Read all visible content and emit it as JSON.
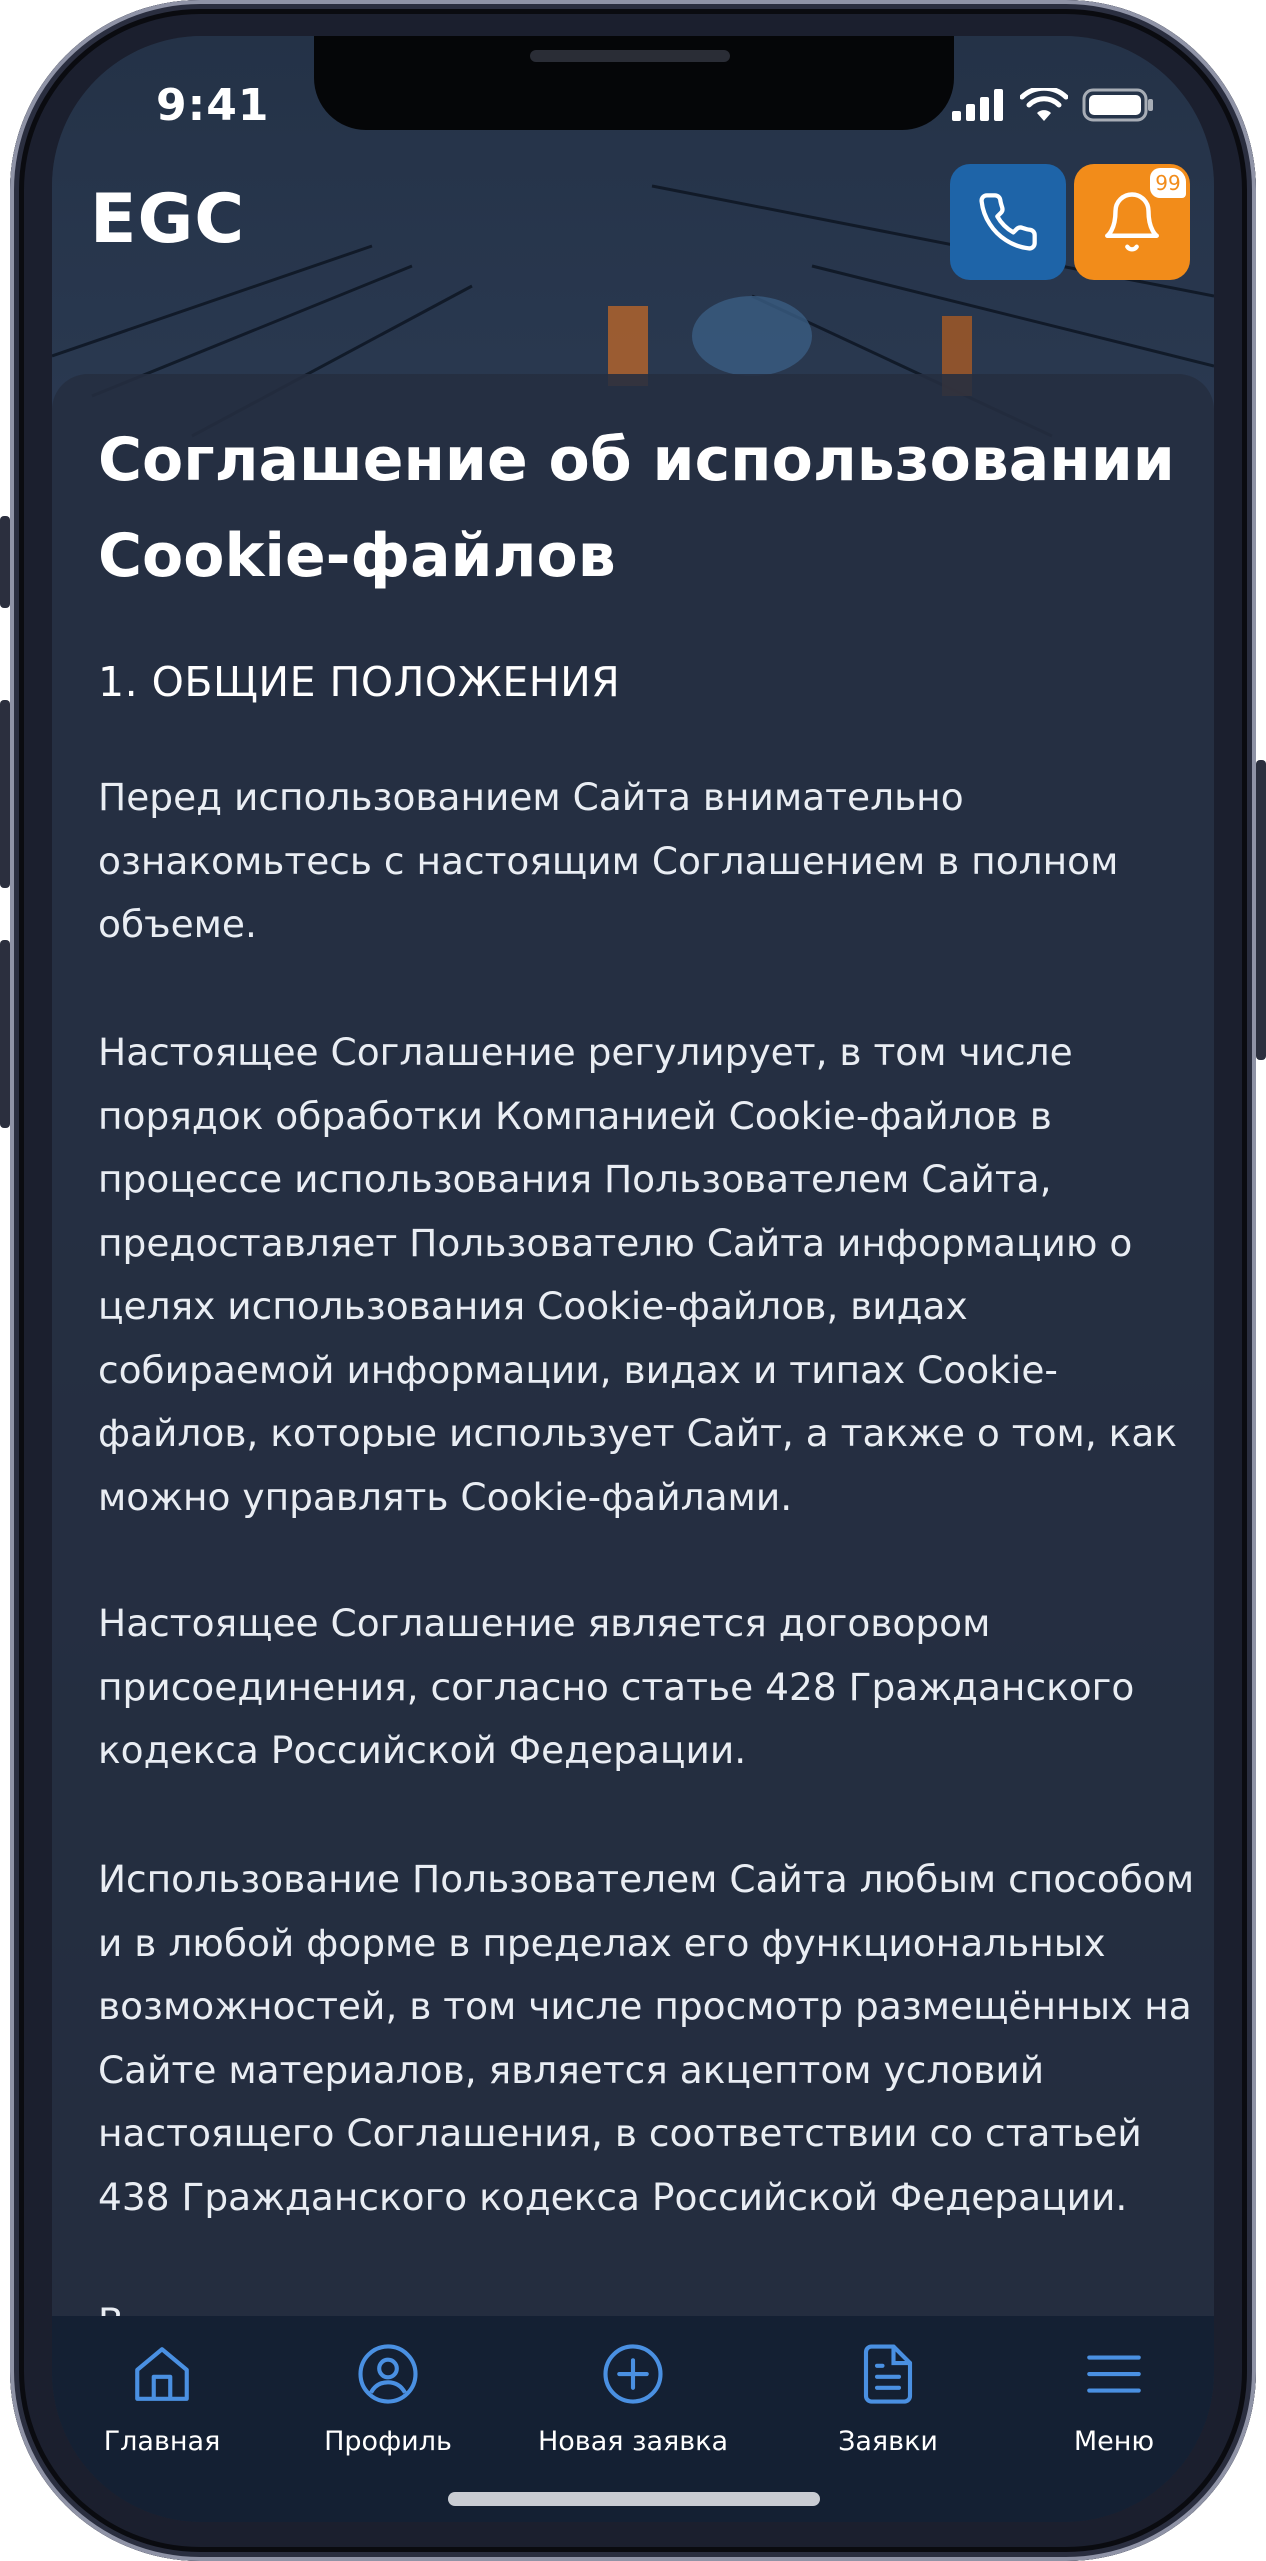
{
  "status_bar": {
    "time": "9:41"
  },
  "header": {
    "app_title": "EGC",
    "notification_count": "99"
  },
  "document": {
    "title": "Соглашение об использовании Cookie-файлов",
    "section_1_title": "1. ОБЩИЕ ПОЛОЖЕНИЯ",
    "paragraphs": [
      "Перед использованием Сайта внимательно ознакомьтесь с настоящим Соглашением в полном объеме.",
      "Настоящее Соглашение регулирует, в том числе порядок обработки Компанией Cookie-файлов в процессе использования Пользователем Сайта, предоставляет Пользователю Сайта информацию о целях использования Cookie-файлов, видах собираемой информации, видах и типах Cookie-файлов, которые использует Сайт, а также о том, как можно управлять Cookie-файлами.",
      "Настоящее Соглашение является договором присоединения, согласно статье 428 Гражданского кодекса Российской Федерации.",
      "Использование Пользователем Сайта любым способом и в любой форме в пределах его функциональных возможностей, в том числе просмотр размещённых на Сайте материалов, является акцептом условий настоящего Соглашения, в соответствии со статьей 438 Гражданского кодекса Российской Федерации.",
      "В"
    ]
  },
  "tabbar": {
    "items": [
      {
        "label": "Главная",
        "icon": "home-icon"
      },
      {
        "label": "Профиль",
        "icon": "profile-icon"
      },
      {
        "label": "Новая заявка",
        "icon": "plus-circle-icon"
      },
      {
        "label": "Заявки",
        "icon": "document-icon"
      },
      {
        "label": "Меню",
        "icon": "menu-icon"
      }
    ]
  },
  "colors": {
    "call_button": "#1e64a8",
    "bell_button": "#f28c1a",
    "tab_icon": "#4a90e2",
    "card_bg": "#242e40"
  }
}
